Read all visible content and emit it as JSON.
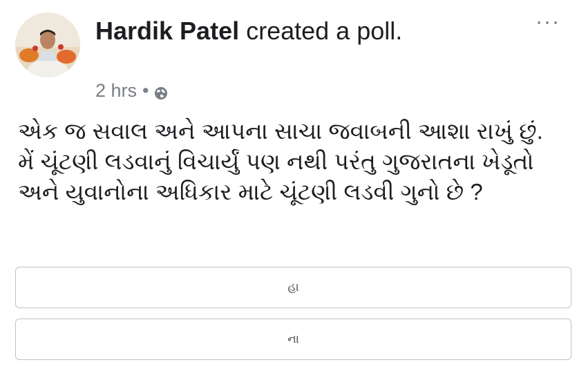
{
  "post": {
    "author": "Hardik Patel",
    "action": " created a poll.",
    "time": "2 hrs",
    "separator": "•",
    "more_label": "···",
    "question": "એક જ સવાલ અને આપના સાચા જવાબની આશા રાખું છું. મેં ચૂંટણી લડવાનું વિચાર્યું પણ નથી પરંતુ ગુજરાતના ખેડૂતો અને યુવાનોના અધિકાર માટે ચૂંટણી લડવી ગુનો છે ?",
    "options": [
      {
        "label": "હા"
      },
      {
        "label": "ના"
      }
    ],
    "privacy_icon": "globe-icon",
    "avatar_icon": "avatar"
  },
  "colors": {
    "text": "#1c1e21",
    "meta": "#7a7f87",
    "border": "#bfc2c7"
  }
}
